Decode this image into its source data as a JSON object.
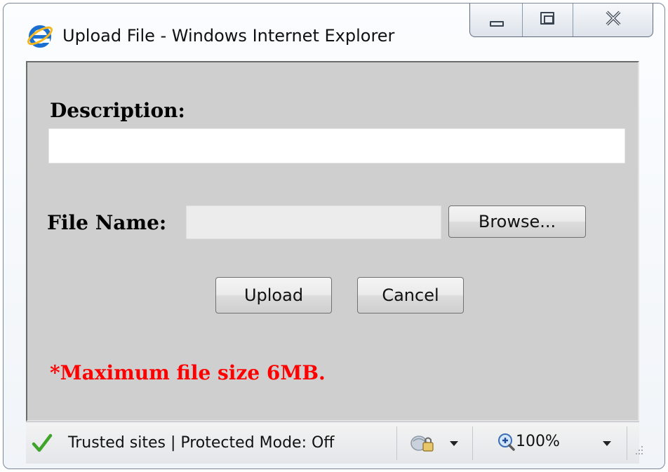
{
  "window": {
    "title": "Upload File - Windows Internet Explorer",
    "icons": {
      "app": "internet-explorer-icon",
      "minimize": "minimize-icon",
      "maximize": "maximize-icon",
      "close": "close-icon"
    }
  },
  "form": {
    "description_label": "Description:",
    "description_value": "",
    "file_name_label": "File Name:",
    "file_name_value": "",
    "browse_label": "Browse...",
    "upload_label": "Upload",
    "cancel_label": "Cancel",
    "max_size_note": "*Maximum file size 6MB."
  },
  "statusbar": {
    "zone_text": "Trusted sites | Protected Mode: Off",
    "zoom_text": "100%",
    "icons": {
      "zone": "checkmark-icon",
      "security": "security-lock-icon",
      "zoom": "magnifier-icon"
    }
  },
  "colors": {
    "content_background": "#cfcfcf",
    "warning_text": "#ff0000",
    "checkmark": "#3ea42a",
    "ie_blue": "#1a6fd1",
    "ie_gold": "#f5b820"
  }
}
